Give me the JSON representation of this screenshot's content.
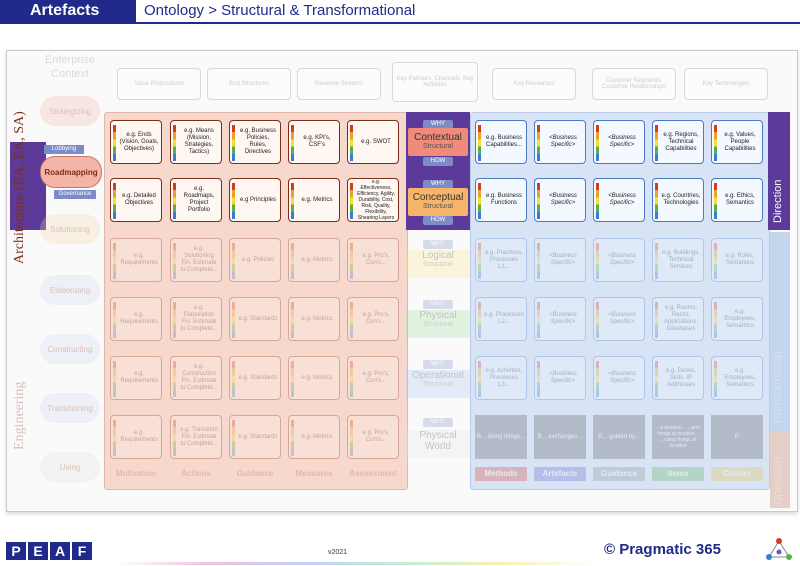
{
  "header": {
    "section": "Artefacts",
    "breadcrumb": "Ontology > Structural & Transformational"
  },
  "enterprise_context": {
    "title": "Enterprise Context",
    "boxes": [
      "Value Propositions",
      "End Structures",
      "Revenue Streams",
      "Key Partners, Channels, Key Activities",
      "Key Resources",
      "Customer Segments, Customer Relationships",
      "Key Technologies"
    ]
  },
  "left": {
    "architecture_label": "Architecture (BA, EA, SA)",
    "engineering_label": "Engineering",
    "strategizing": "Strategizing",
    "lobbying": "Lobbying",
    "roadmapping": "Roadmapping",
    "governance": "Governance",
    "solutioning": "Solutioning",
    "elaborating": "Elaborating",
    "constructing": "Constructing",
    "transitioning": "Transitioning",
    "using": "Using"
  },
  "middle": {
    "why": "WHY",
    "how": "HOW",
    "contextual": "Contextual",
    "conceptual": "Conceptual",
    "logical": "Logical",
    "physical": "Physical",
    "operational": "Operational",
    "physical_world": "Physical World",
    "structural": "Structural"
  },
  "rows": {
    "contextual_red": [
      "e.g. Ends (Vision, Goals, Objectives)",
      "e.g. Means (Mission, Strategies, Tactics)",
      "e.g. Business Policies, Rules, Directives",
      "e.g. KPI's, CSF's",
      "e.g. SWOT"
    ],
    "contextual_blue": [
      "e.g. Business Capabilities...",
      "<Business Specific>",
      "<Business Specific>",
      "e.g. Regions, Technical Capabilities",
      "e.g. Values, People Capabilities"
    ],
    "conceptual_red": [
      "e.g. Detailed Objectives",
      "e.g. Roadmaps, Project Portfolio",
      "e.g Principles",
      "e.g. Metrics",
      "e.g. Effectiveness, Efficiency, Agility, Durability, Cost, Risk, Quality, Flexibility, Shearing Layers"
    ],
    "conceptual_blue": [
      "e.g. Business Functions",
      "<Business Specific>",
      "<Business Specific>",
      "e.g. Countries, Technologies",
      "e.g. Ethics, Semantics"
    ],
    "logical_red": [
      "e.g. Requirements",
      "e.g. Solutioning Fin. Estimate to Complete...",
      "e.g. Policies",
      "e.g. Metrics",
      "e.g. Pro's, Con's..."
    ],
    "logical_blue": [
      "e.g. Practices, Processes L1...",
      "<Business Specific>",
      "<Business Specific>",
      "e.g. Buildings, Technical Services",
      "e.g. Roles, Semantics"
    ],
    "physical_red": [
      "e.g. Requirements",
      "e.g. Elaboration Fin. Estimate to Complete...",
      "e.g. Standards",
      "e.g. Metrics",
      "e.g. Pro's, Con's..."
    ],
    "physical_blue": [
      "e.g. Processes L2...",
      "<Business Specific>",
      "<Business Specific>",
      "e.g. Rooms, Racks, Applications, Databases",
      "e.g. Employees, Semantics"
    ],
    "operational_red": [
      "e.g. Requirements",
      "e.g. Construction Fin. Estimate to Complete...",
      "e.g. Standards",
      "e.g. Metrics",
      "e.g. Pro's, Con's..."
    ],
    "operational_blue": [
      "e.g. Activities, Processes L3...",
      "<Business Specific>",
      "<Business Specific>",
      "e.g. Desks, Slots, IP Addresses",
      "e.g. Employees, Semantics"
    ],
    "world_red": [
      "e.g. Requirements",
      "e.g. Transition Fin. Estimate to Complete...",
      "e.g. Standards",
      "e.g. Metrics",
      "e.g. Pro's, Con's..."
    ],
    "world_blue": [
      "B... doing things...",
      "B... exchanges...",
      "B... guided by...",
      "...a location... ...and things at location... ...using things at location",
      "P"
    ]
  },
  "bottom": {
    "motivation": "Motivation",
    "actions": "Actions",
    "guidance": "Guidance",
    "measures": "Measures",
    "assessment": "Assessment",
    "methods": "Methods",
    "artefacts": "Artefacts",
    "guidance2": "Guidance",
    "items": "Items",
    "culture": "Culture"
  },
  "side": {
    "direction": "Direction",
    "transformation": "Transformation",
    "operation": "Operation"
  },
  "footer": {
    "logo": [
      "P",
      "E",
      "A",
      "F"
    ],
    "version": "v2021",
    "brand": "© Pragmatic 365"
  },
  "colors": {
    "navy": "#1f2a8a",
    "red_col": "#f7d8cc",
    "blue_col": "#d8e4f6",
    "purple": "#5b3a9a"
  }
}
